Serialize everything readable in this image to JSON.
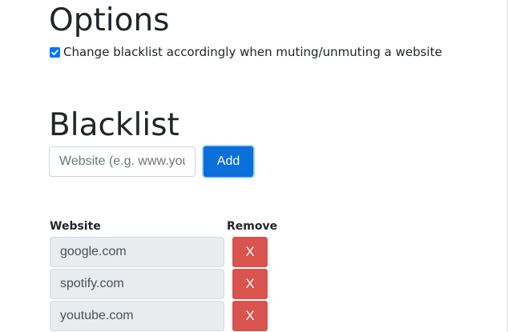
{
  "options": {
    "heading": "Options",
    "change_blacklist": {
      "label": "Change blacklist accordingly when muting/unmuting a website",
      "checked": true
    }
  },
  "blacklist": {
    "heading": "Blacklist",
    "input_placeholder": "Website (e.g. www.youtube.com)",
    "add_label": "Add",
    "columns": {
      "website": "Website",
      "remove": "Remove"
    },
    "rows": [
      {
        "website": "google.com",
        "remove_label": "X"
      },
      {
        "website": "spotify.com",
        "remove_label": "X"
      },
      {
        "website": "youtube.com",
        "remove_label": "X"
      }
    ]
  },
  "colors": {
    "primary": "#0b6fd9",
    "danger": "#d9534f",
    "checkbox": "#0075ff"
  }
}
